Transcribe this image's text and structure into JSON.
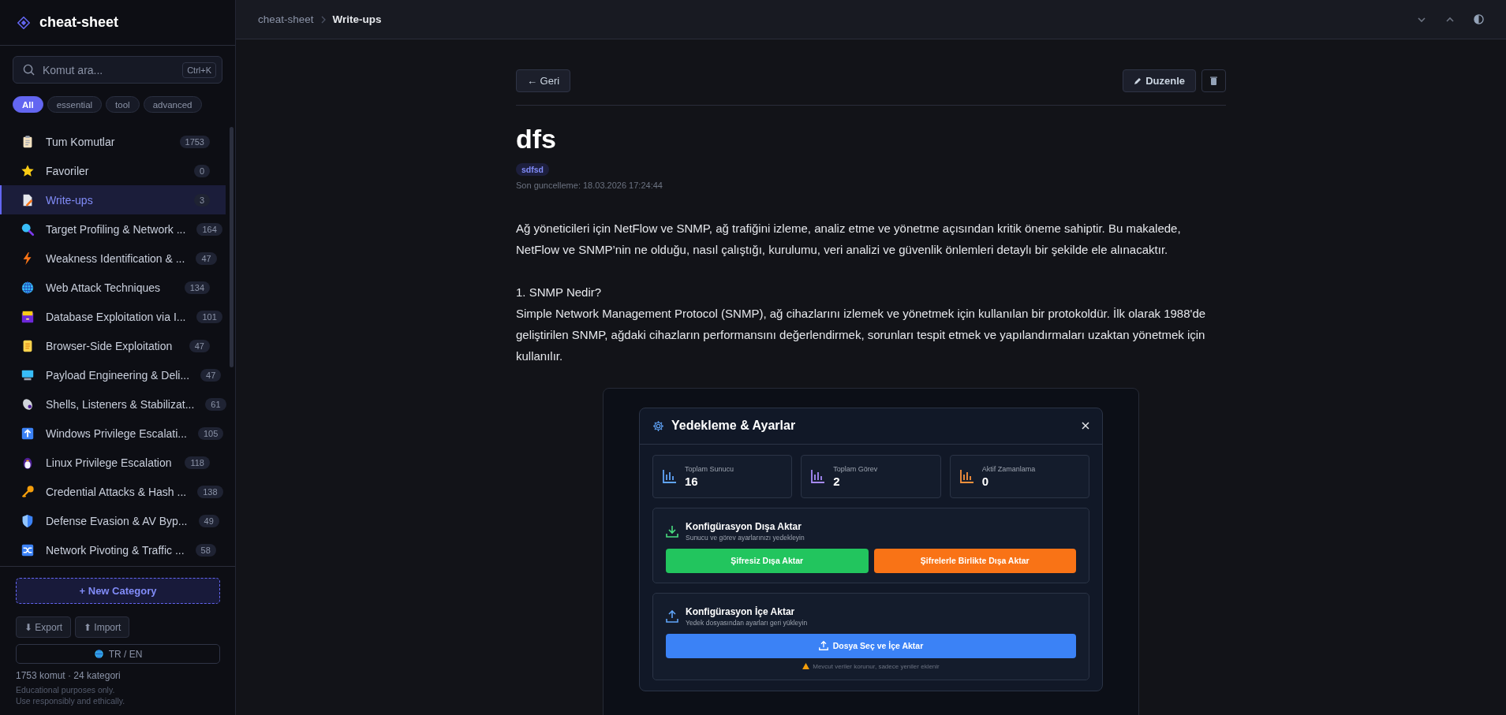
{
  "sidebar": {
    "brand": "cheat-sheet",
    "search": {
      "placeholder": "Komut ara...",
      "shortcut": "Ctrl+K"
    },
    "filters": [
      {
        "label": "All",
        "selected": true
      },
      {
        "label": "essential",
        "selected": false
      },
      {
        "label": "tool",
        "selected": false
      },
      {
        "label": "advanced",
        "selected": false
      }
    ],
    "items": [
      {
        "label": "Tum Komutlar",
        "count": "1753",
        "selected": false
      },
      {
        "label": "Favoriler",
        "count": "0",
        "selected": false
      },
      {
        "label": "Write-ups",
        "count": "3",
        "selected": true
      },
      {
        "label": "Target Profiling & Network ...",
        "count": "164",
        "selected": false
      },
      {
        "label": "Weakness Identification & ...",
        "count": "47",
        "selected": false
      },
      {
        "label": "Web Attack Techniques",
        "count": "134",
        "selected": false
      },
      {
        "label": "Database Exploitation via I...",
        "count": "101",
        "selected": false
      },
      {
        "label": "Browser-Side Exploitation",
        "count": "47",
        "selected": false
      },
      {
        "label": "Payload Engineering & Deli...",
        "count": "47",
        "selected": false
      },
      {
        "label": "Shells, Listeners & Stabilizat...",
        "count": "61",
        "selected": false
      },
      {
        "label": "Windows Privilege Escalati...",
        "count": "105",
        "selected": false
      },
      {
        "label": "Linux Privilege Escalation",
        "count": "118",
        "selected": false
      },
      {
        "label": "Credential Attacks & Hash ...",
        "count": "138",
        "selected": false
      },
      {
        "label": "Defense Evasion & AV Byp...",
        "count": "49",
        "selected": false
      },
      {
        "label": "Network Pivoting & Traffic ...",
        "count": "58",
        "selected": false
      }
    ],
    "new_category": "+ New Category",
    "export": "⬇ Export",
    "import": "⬆ Import",
    "language": "TR / EN",
    "summary": "1753 komut · 24 kategori",
    "disclaimer": [
      "Educational purposes only.",
      "Use responsibly and ethically."
    ]
  },
  "breadcrumb": [
    {
      "label": "cheat-sheet",
      "selected": false
    },
    {
      "label": "Write-ups",
      "selected": true
    }
  ],
  "article": {
    "back": "← Geri",
    "edit": "Duzenle",
    "title": "dfs",
    "tags": [
      "sdfsd"
    ],
    "updated": "Son guncelleme: 18.03.2026 17:24:44",
    "body": [
      [
        "Ağ yöneticileri için NetFlow ve SNMP, ağ trafiğini izleme, analiz etme ve yönetme açısından kritik öneme sahiptir. Bu makalede, NetFlow ve SNMP’nin ne olduğu, nasıl çalıştığı, kurulumu, veri analizi ve güvenlik önlemleri detaylı bir şekilde ele alınacaktır."
      ],
      [
        "1. SNMP Nedir?",
        "Simple Network Management Protocol (SNMP), ağ cihazlarını izlemek ve yönetmek için kullanılan bir protokoldür. İlk olarak 1988'de geliştirilen SNMP, ağdaki cihazların performansını değerlendirmek, sorunları tespit etmek ve yapılandırmaları uzaktan yönetmek için kullanılır."
      ]
    ],
    "screenshot": {
      "title": "Yedekleme & Ayarlar",
      "stats": [
        {
          "label": "Toplam Sunucu",
          "value": "16",
          "color": "#60a5fa"
        },
        {
          "label": "Toplam Görev",
          "value": "2",
          "color": "#a78bfa"
        },
        {
          "label": "Aktif Zamanlama",
          "value": "0",
          "color": "#fb923c"
        }
      ],
      "sections": [
        {
          "kind": "export",
          "title": "Konfigürasyon Dışa Aktar",
          "subtitle": "Sunucu ve görev ayarlarınızı yedekleyin",
          "buttons": [
            {
              "label": "Şifresiz Dışa Aktar",
              "color": "#22c55e"
            },
            {
              "label": "Şifrelerle Birlikte Dışa Aktar",
              "color": "#f97316"
            }
          ]
        },
        {
          "kind": "import",
          "title": "Konfigürasyon İçe Aktar",
          "subtitle": "Yedek dosyasından ayarları geri yükleyin",
          "buttons": [
            {
              "label": "Dosya Seç ve İçe Aktar",
              "color": "#3b82f6"
            }
          ],
          "note": "Mevcut veriler korunur, sadece yeniler eklenir"
        }
      ]
    }
  }
}
